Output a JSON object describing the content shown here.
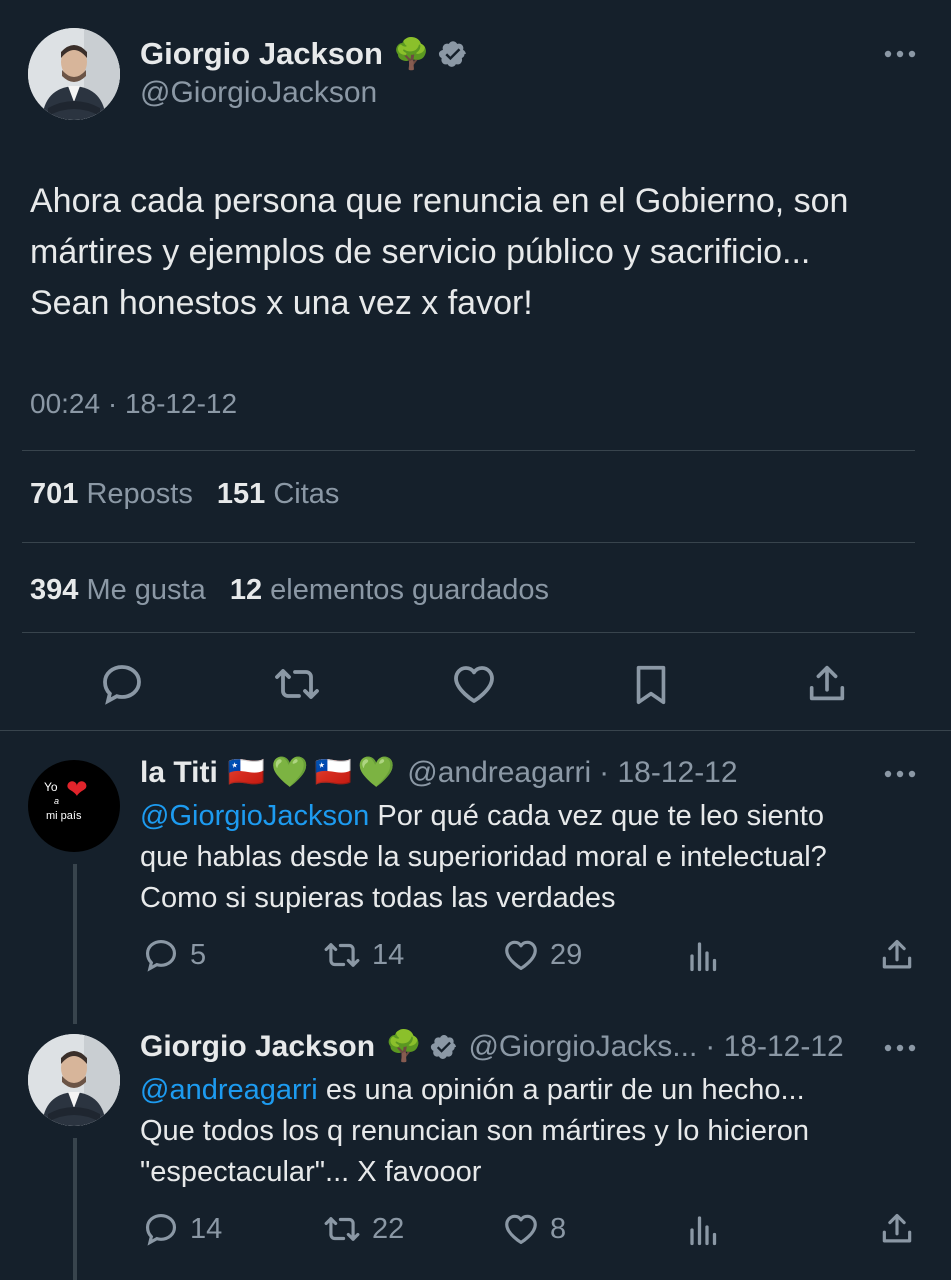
{
  "main_tweet": {
    "author_name": "Giorgio Jackson",
    "author_handle": "@GiorgioJackson",
    "tree_emoji": "🌳",
    "text_lines": [
      "Ahora cada persona que renuncia en el Gobierno, son",
      "mártires y ejemplos de servicio público y sacrificio...",
      "Sean honestos x una vez x favor!"
    ],
    "timestamp": "00:24 · 18-12-12",
    "stats": {
      "reposts_count": "701",
      "reposts_label": "Reposts",
      "quotes_count": "151",
      "quotes_label": "Citas",
      "likes_count": "394",
      "likes_label": "Me gusta",
      "bookmarks_count": "12",
      "bookmarks_label": "elementos guardados"
    }
  },
  "reply_1": {
    "author_name": "la Titi",
    "flag_emoji": "🇨🇱",
    "heart_emoji": "💚",
    "author_handle": "@andreagarri",
    "date": "· 18-12-12",
    "mention": "@GiorgioJackson",
    "text_first": " Por qué cada vez que te leo siento",
    "text_lines": [
      "que hablas desde la superioridad moral e intelectual?",
      "Como si supieras todas las verdades"
    ],
    "avatar_text_top": "Yo",
    "avatar_text_mid": "a",
    "avatar_text_bottom": "mi país",
    "replies": "5",
    "reposts": "14",
    "likes": "29"
  },
  "reply_2": {
    "author_name": "Giorgio Jackson",
    "tree_emoji": "🌳",
    "author_handle": "@GiorgioJacks...",
    "date": "· 18-12-12",
    "mention": "@andreagarri",
    "text_first": " es una opinión a partir de un hecho...",
    "text_lines": [
      "Que todos los q renuncian son mártires y lo hicieron",
      "\"espectacular\"... X favooor"
    ],
    "replies": "14",
    "reposts": "22",
    "likes": "8"
  },
  "colors": {
    "background": "#15202b",
    "text": "#e7e9ea",
    "muted": "#8b98a5",
    "link": "#1d9bf0",
    "divider": "#38444d"
  }
}
